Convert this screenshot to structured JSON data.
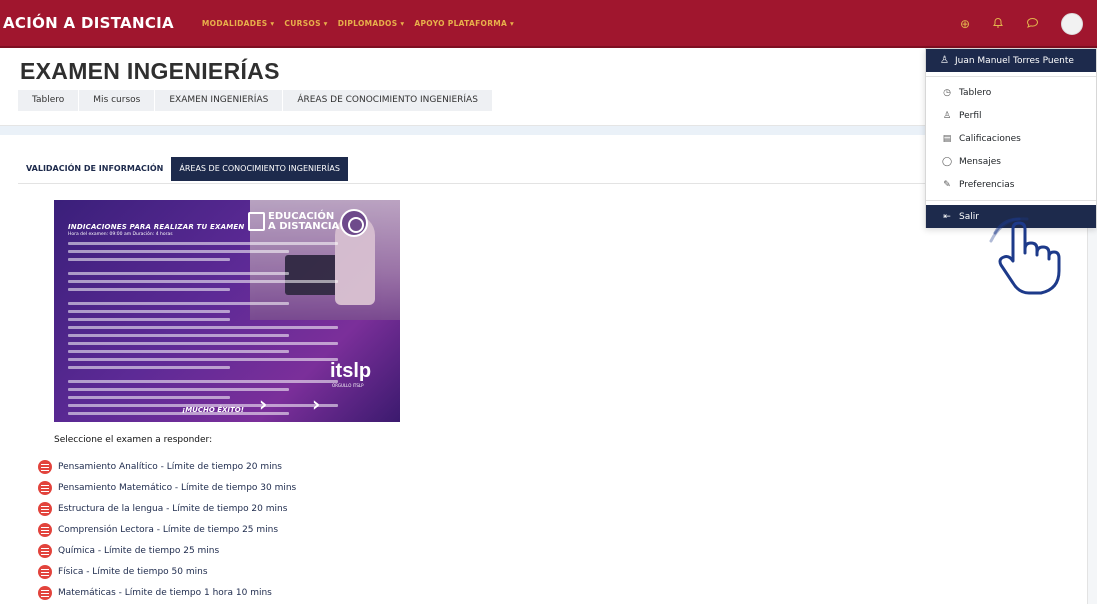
{
  "navbar": {
    "brand": "ACIÓN A DISTANCIA",
    "menu": [
      {
        "label": "MODALIDADES ▾"
      },
      {
        "label": "CURSOS ▾"
      },
      {
        "label": "DIPLOMADOS ▾"
      },
      {
        "label": "APOYO PLATAFORMA ▾"
      }
    ],
    "icons": {
      "globe": "⊕",
      "bell": "♫",
      "chat": "◯"
    }
  },
  "page": {
    "title": "EXAMEN INGENIERÍAS",
    "breadcrumb": [
      "Tablero",
      "Mis cursos",
      "EXAMEN INGENIERÍAS",
      "ÁREAS DE CONOCIMIENTO INGENIERÍAS"
    ]
  },
  "tabs": [
    {
      "label": "VALIDACIÓN DE INFORMACIÓN",
      "active": false
    },
    {
      "label": "ÁREAS DE CONOCIMIENTO INGENIERÍAS",
      "active": true
    }
  ],
  "banner": {
    "heading": "INDICACIONES PARA REALIZAR TU EXAMEN",
    "subheading": "Hora del examen: 09:00 am    Duración: 4 horas",
    "brand_line1": "EDUCACIÓN",
    "brand_line2": "A DISTANCIA",
    "logo": "itslp",
    "logo_sub": "ORGULLO ITSLP",
    "cheer": "¡MUCHO ÉXITO!"
  },
  "prompt": "Seleccione el examen a responder:",
  "exams": [
    "Pensamiento Analítico - Límite de tiempo 20 mins",
    "Pensamiento Matemático - Límite de tiempo 30 mins",
    "Estructura de la lengua - Límite de tiempo 20 mins",
    "Comprensión Lectora - Límite de tiempo 25 mins",
    "Química - Límite de tiempo 25 mins",
    "Física - Límite de tiempo 50 mins",
    "Matemáticas - Límite de tiempo 1 hora 10 mins"
  ],
  "user_menu": {
    "user_name": "Juan Manuel Torres Puente",
    "items": [
      {
        "label": "Tablero",
        "icon": "◷"
      },
      {
        "label": "Perfil",
        "icon": "♙"
      },
      {
        "label": "Calificaciones",
        "icon": "▤"
      },
      {
        "label": "Mensajes",
        "icon": "◯"
      },
      {
        "label": "Preferencias",
        "icon": "✎"
      }
    ],
    "logout": {
      "label": "Salir",
      "icon": "⇤"
    }
  },
  "colors": {
    "navbar": "#a0162e",
    "menu_text": "#e8b04b",
    "dark_blue": "#1d2a4c",
    "exam_icon": "#e2433c"
  }
}
